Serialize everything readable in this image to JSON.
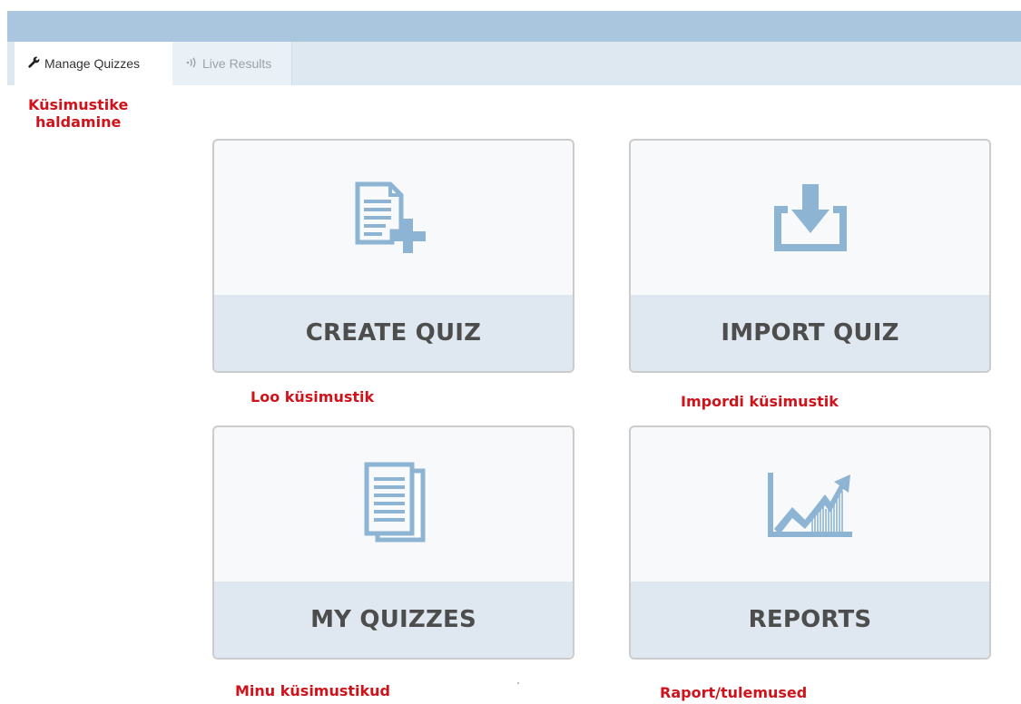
{
  "tabs": [
    {
      "label": "Manage Quizzes",
      "icon": "wrench-icon",
      "active": true
    },
    {
      "label": "Live Results",
      "icon": "broadcast-icon",
      "active": false
    }
  ],
  "annotations": {
    "header_line1": "Küsimustike",
    "header_line2": "haldamine",
    "create": "Loo küsimustik",
    "import": "Impordi küsimustik",
    "my_quizzes": "Minu küsimustikud",
    "reports": "Raport/tulemused"
  },
  "cards": {
    "create": {
      "label": "CREATE QUIZ",
      "icon": "document-plus-icon"
    },
    "import": {
      "label": "IMPORT QUIZ",
      "icon": "download-tray-icon"
    },
    "my_quizzes": {
      "label": "MY QUIZZES",
      "icon": "documents-stack-icon"
    },
    "reports": {
      "label": "REPORTS",
      "icon": "trend-chart-icon"
    }
  },
  "colors": {
    "annotation": "#d0131b",
    "icon_blue": "#8eb4d4",
    "top_bar": "#a9c6de",
    "tab_bar": "#dde8f1",
    "card_label_bg": "#dfe8f0",
    "card_text": "#4d4d4d"
  }
}
